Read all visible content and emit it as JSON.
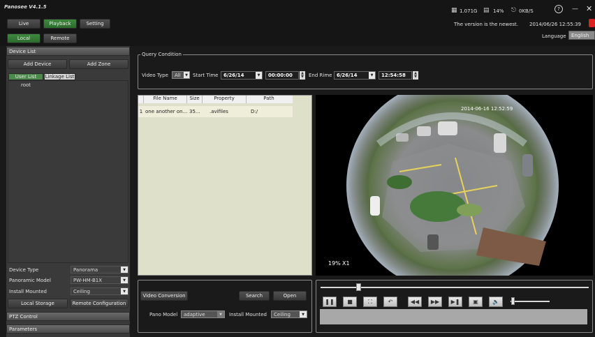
{
  "app": {
    "title": "Panosee V4.1.5"
  },
  "top_tabs": {
    "live": "Live",
    "playback": "Playback",
    "setting": "Setting"
  },
  "sub_tabs": {
    "local": "Local",
    "remote": "Remote"
  },
  "status": {
    "disk": "1.071G",
    "cpu": "14%",
    "net": "0KB/S",
    "version_msg": "The version is the newest.",
    "datetime": "2014/06/26 12:55:39",
    "language_label": "Language",
    "language_value": "English"
  },
  "window_controls": {
    "help": "?",
    "minimize": "—",
    "close": "✕"
  },
  "sidebar": {
    "device_list_header": "Device List",
    "add_device": "Add Device",
    "add_zone": "Add Zone",
    "user_list_tab": "User List",
    "linkage_list_tab": "Linkage List",
    "tree_root": "root",
    "device_type_label": "Device Type",
    "device_type_value": "Panorama",
    "panoramic_model_label": "Panoramic Model",
    "panoramic_model_value": "PW-HM-B1X",
    "install_mounted_label": "Install Mounted",
    "install_mounted_value": "Ceiling",
    "local_storage": "Local Storage",
    "remote_config": "Remote Configuration",
    "ptz_control": "PTZ Control",
    "parameters": "Parameters"
  },
  "query": {
    "title": "Query Condition",
    "video_type_label": "Video Type",
    "video_type_value": "All",
    "start_time_label": "Start Time",
    "start_date": "6/26/14",
    "start_time": "00:00:00",
    "end_time_label": "End Rime",
    "end_date": "6/26/14",
    "end_time": "12:54:58"
  },
  "file_table": {
    "columns": [
      "File Name",
      "Size",
      "Property",
      "Path"
    ],
    "rows": [
      {
        "index": "1",
        "file_name": "one another on...",
        "size": "35...",
        "property": ".avifiles",
        "path": "D:/"
      }
    ]
  },
  "video": {
    "timestamp": "2014-06-16 12:52:59",
    "zoom": "19%",
    "speed": "X1"
  },
  "bottom": {
    "video_conversion": "Video Conversion",
    "search": "Search",
    "open": "Open",
    "pano_model_label": "Pano Model",
    "pano_model_value": "adaptive",
    "install_mounted_label": "Install Mounted",
    "install_mounted_value": "Ceiling"
  },
  "playback": {
    "progress": 0.14,
    "volume": 0.05
  }
}
